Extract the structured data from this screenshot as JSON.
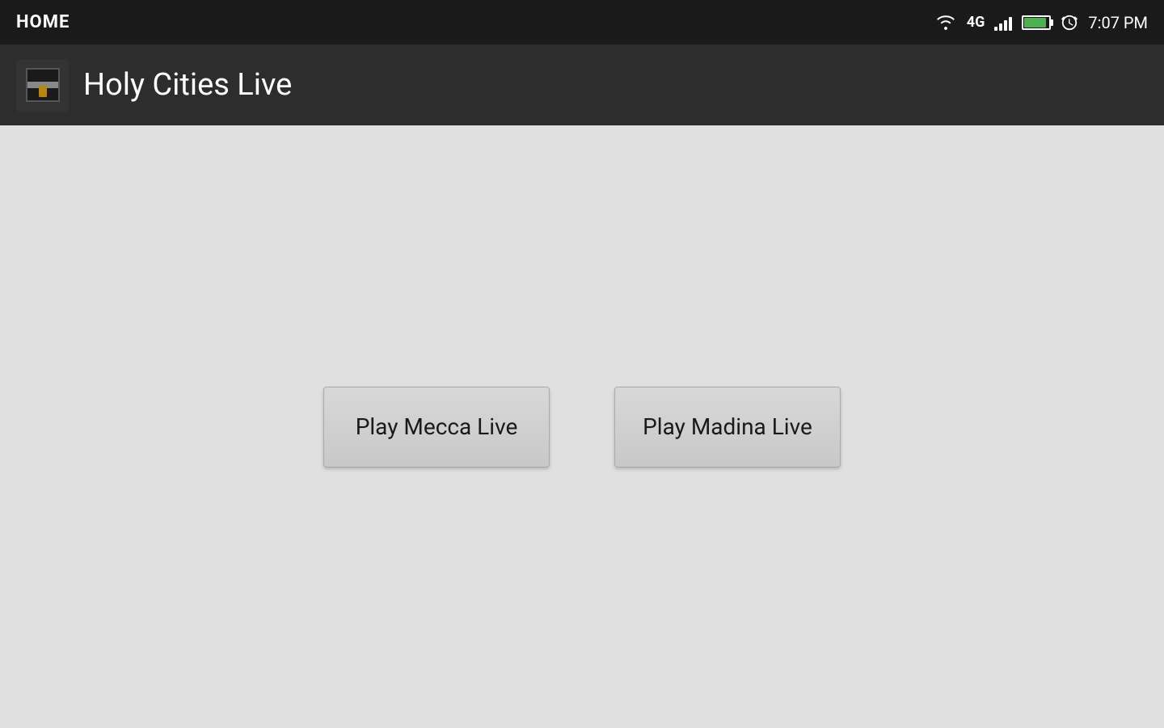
{
  "status_bar": {
    "home_label": "HOME",
    "time": "7:07 PM",
    "badge_4g": "4G"
  },
  "app_bar": {
    "title": "Holy Cities Live"
  },
  "main": {
    "button_mecca_label": "Play Mecca Live",
    "button_madina_label": "Play Madina Live"
  }
}
